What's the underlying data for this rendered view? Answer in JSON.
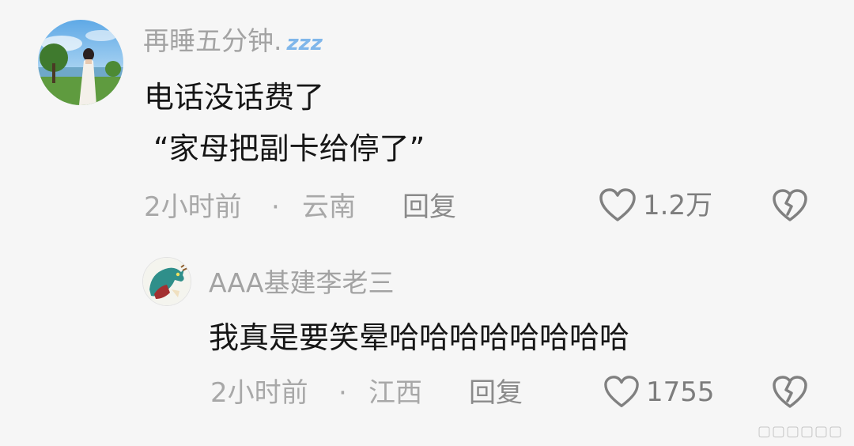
{
  "comments": [
    {
      "username": "再睡五分钟.",
      "username_emoji": "💤",
      "lines": [
        "电话没话费了",
        "“家母把副卡给停了”"
      ],
      "time": "2小时前",
      "separator": "·",
      "location": "云南",
      "reply_label": "回复",
      "likes": "1.2万"
    }
  ],
  "replies": [
    {
      "username": "AAA基建李老三",
      "lines": [
        "我真是要笑晕哈哈哈哈哈哈哈哈"
      ],
      "time": "2小时前",
      "separator": "·",
      "location": "江西",
      "reply_label": "回复",
      "likes": "1755"
    }
  ],
  "colors": {
    "background": "#f6f6f6",
    "username": "#a3a3a3",
    "content": "#161616",
    "meta": "#a8a8a8",
    "icon": "#808080"
  },
  "icons": {
    "like": "heart-outline-icon",
    "dislike": "broken-heart-icon",
    "sleep": "zzz-icon"
  },
  "watermark": "▢▢▢▢▢▢"
}
